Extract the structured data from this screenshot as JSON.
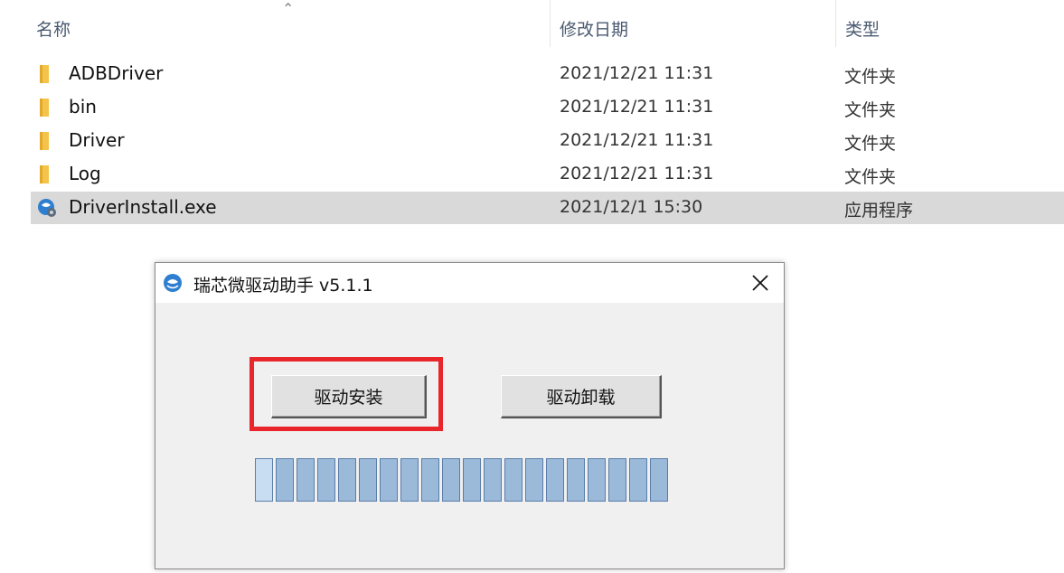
{
  "explorer": {
    "columns": {
      "name": "名称",
      "date_modified": "修改日期",
      "type": "类型"
    },
    "rows": [
      {
        "name": "ADBDriver",
        "date": "2021/12/21 11:31",
        "type": "文件夹",
        "kind": "folder-icon"
      },
      {
        "name": "bin",
        "date": "2021/12/21 11:31",
        "type": "文件夹",
        "kind": "folder-icon"
      },
      {
        "name": "Driver",
        "date": "2021/12/21 11:31",
        "type": "文件夹",
        "kind": "folder-icon"
      },
      {
        "name": "Log",
        "date": "2021/12/21 11:31",
        "type": "文件夹",
        "kind": "folder-icon"
      },
      {
        "name": "DriverInstall.exe",
        "date": "2021/12/1 15:30",
        "type": "应用程序",
        "kind": "exe-icon",
        "selected": true
      }
    ]
  },
  "dialog": {
    "title": "瑞芯微驱动助手 v5.1.1",
    "install_label": "驱动安装",
    "uninstall_label": "驱动卸载",
    "highlight_color": "#e8262b"
  },
  "progress": {
    "segments": 20
  }
}
